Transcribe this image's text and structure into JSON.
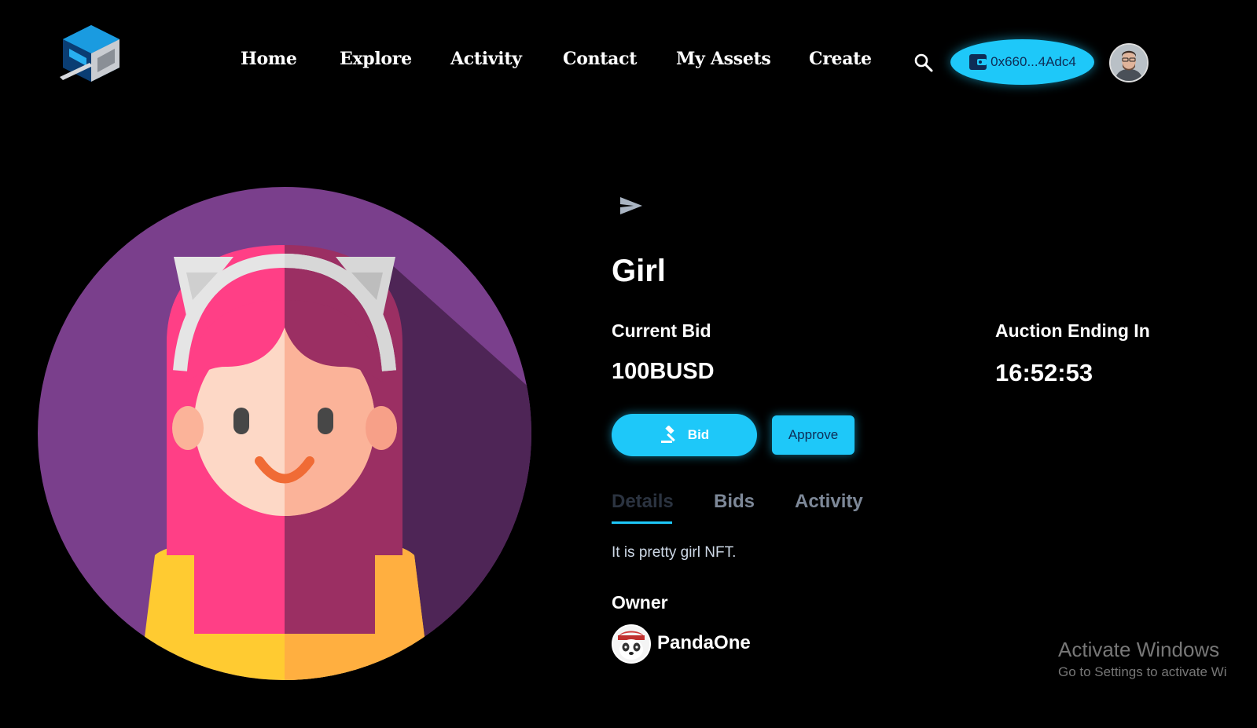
{
  "header": {
    "logo_icon": "cube-logo-icon",
    "nav": [
      {
        "label": "Home"
      },
      {
        "label": "Explore"
      },
      {
        "label": "Activity"
      },
      {
        "label": "Contact"
      },
      {
        "label": "My Assets"
      },
      {
        "label": "Create"
      }
    ],
    "search_icon": "search-icon",
    "wallet": {
      "icon": "wallet-icon",
      "address": "0x660...4Adc4"
    },
    "avatar_icon": "user-avatar"
  },
  "item": {
    "image": "girl-avatar-artwork",
    "share_icon": "send-icon",
    "title": "Girl",
    "current_bid_label": "Current Bid",
    "current_bid_value": "100BUSD",
    "auction_label": "Auction Ending In",
    "auction_time": "16:52:53",
    "bid_button": "Bid",
    "bid_icon": "gavel-icon",
    "approve_button": "Approve",
    "tabs": [
      {
        "label": "Details",
        "active": true
      },
      {
        "label": "Bids",
        "active": false
      },
      {
        "label": "Activity",
        "active": false
      }
    ],
    "description": "It is pretty girl NFT.",
    "owner_label": "Owner",
    "owner_name": "PandaOne",
    "owner_avatar": "panda-avatar"
  },
  "watermark": {
    "title": "Activate Windows",
    "subtitle": "Go to Settings to activate Wi"
  },
  "colors": {
    "accent": "#1ec8f9",
    "background": "#000000",
    "art_circle": "#7a3f8c",
    "hair_light": "#ff3f86",
    "hair_dark": "#9b2f63"
  }
}
